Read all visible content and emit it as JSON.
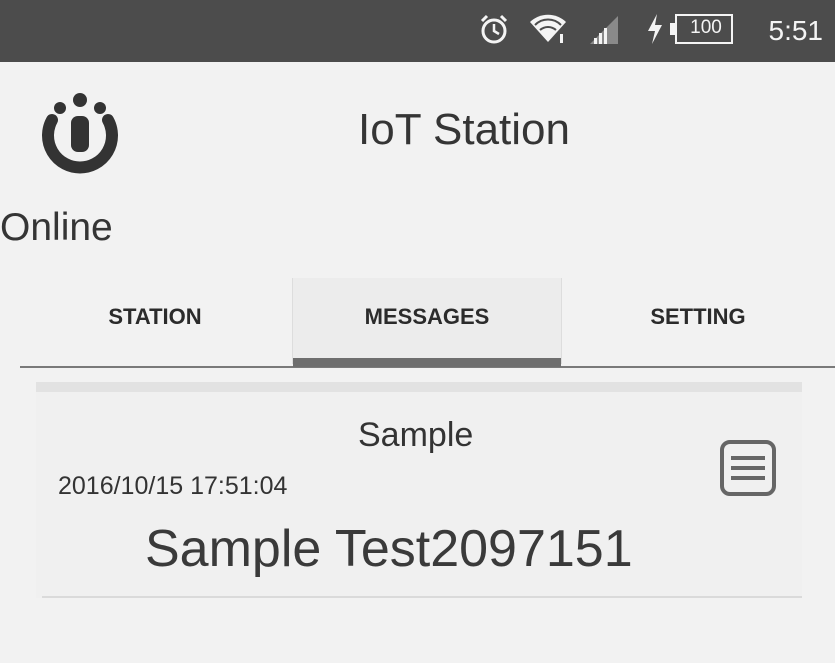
{
  "status_bar": {
    "time": "5:51",
    "battery_level": "100",
    "icons": [
      "alarm-clock-icon",
      "wifi-icon",
      "cell-signal-icon",
      "charging-icon",
      "battery-icon"
    ]
  },
  "header": {
    "logo_icon": "power-logo-icon",
    "title": "IoT Station",
    "connection_status": "Online"
  },
  "tabs": [
    {
      "label": "STATION",
      "selected": false
    },
    {
      "label": "MESSAGES",
      "selected": true
    },
    {
      "label": "SETTING",
      "selected": false
    }
  ],
  "messages": [
    {
      "title": "Sample",
      "timestamp": "2016/10/15 17:51:04",
      "body": "Sample Test2097151",
      "icon": "message-detail-icon"
    }
  ],
  "colors": {
    "status_bar": "#4c4c4c",
    "background": "#f2f2f2",
    "tab_indicator": "#6e6e6e",
    "text": "#333333"
  }
}
